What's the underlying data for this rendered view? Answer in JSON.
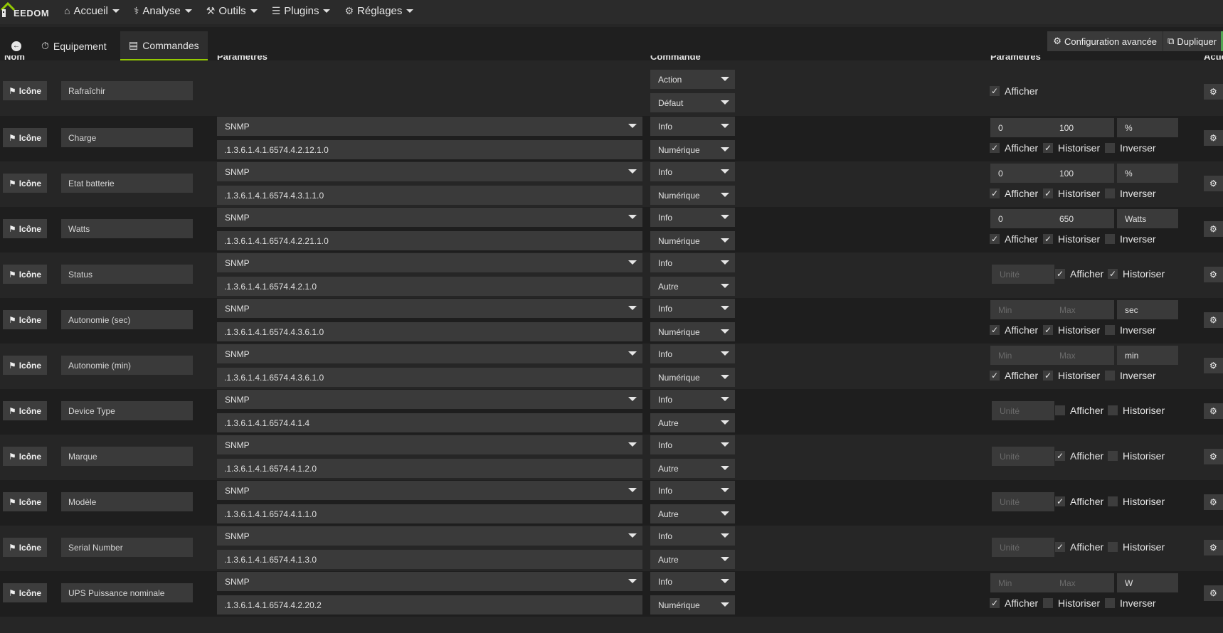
{
  "brand": "EEDOM",
  "nav": [
    {
      "label": "Accueil",
      "icon": "home-icon"
    },
    {
      "label": "Analyse",
      "icon": "stethoscope-icon"
    },
    {
      "label": "Outils",
      "icon": "wrench-icon"
    },
    {
      "label": "Plugins",
      "icon": "tasks-icon"
    },
    {
      "label": "Réglages",
      "icon": "gear-icon"
    }
  ],
  "tabs": {
    "equipement": "Equipement",
    "commandes": "Commandes"
  },
  "actions": {
    "advanced": "Configuration avancée",
    "duplicate": "Dupliquer"
  },
  "headers": {
    "nom": "Nom",
    "parametres": "Paramètres",
    "commande": "Commande",
    "parametres2": "Paramètres",
    "action": "Action"
  },
  "labels": {
    "icon_button": "Icône",
    "afficher": "Afficher",
    "historiser": "Historiser",
    "inverser": "Inverser",
    "min_placeholder": "Min",
    "max_placeholder": "Max",
    "unit_placeholder": "Unité"
  },
  "first_row": {
    "name": "Rafraîchir",
    "type": "Action",
    "subtype": "Défaut",
    "afficher": true
  },
  "rows": [
    {
      "name": "Charge",
      "protocol": "SNMP",
      "oid": ".1.3.6.1.4.1.6574.4.2.12.1.0",
      "type": "Info",
      "subtype": "Numérique",
      "layout": "minmax",
      "min": "0",
      "max": "100",
      "unit": "%",
      "afficher": true,
      "historiser": true,
      "inverser": false
    },
    {
      "name": "Etat batterie",
      "protocol": "SNMP",
      "oid": ".1.3.6.1.4.1.6574.4.3.1.1.0",
      "type": "Info",
      "subtype": "Numérique",
      "layout": "minmax",
      "min": "0",
      "max": "100",
      "unit": "%",
      "afficher": true,
      "historiser": true,
      "inverser": false
    },
    {
      "name": "Watts",
      "protocol": "SNMP",
      "oid": ".1.3.6.1.4.1.6574.4.2.21.1.0",
      "type": "Info",
      "subtype": "Numérique",
      "layout": "minmax",
      "min": "0",
      "max": "650",
      "unit": "Watts",
      "afficher": true,
      "historiser": true,
      "inverser": false
    },
    {
      "name": "Status",
      "protocol": "SNMP",
      "oid": ".1.3.6.1.4.1.6574.4.2.1.0",
      "type": "Info",
      "subtype": "Autre",
      "layout": "unit",
      "unit": "",
      "afficher": true,
      "historiser": true
    },
    {
      "name": "Autonomie (sec)",
      "protocol": "SNMP",
      "oid": ".1.3.6.1.4.1.6574.4.3.6.1.0",
      "type": "Info",
      "subtype": "Numérique",
      "layout": "minmax",
      "min": "",
      "max": "",
      "unit": "sec",
      "afficher": true,
      "historiser": true,
      "inverser": false
    },
    {
      "name": "Autonomie (min)",
      "protocol": "SNMP",
      "oid": ".1.3.6.1.4.1.6574.4.3.6.1.0",
      "type": "Info",
      "subtype": "Numérique",
      "layout": "minmax",
      "min": "",
      "max": "",
      "unit": "min",
      "afficher": true,
      "historiser": true,
      "inverser": false
    },
    {
      "name": "Device Type",
      "protocol": "SNMP",
      "oid": ".1.3.6.1.4.1.6574.4.1.4",
      "type": "Info",
      "subtype": "Autre",
      "layout": "unit",
      "unit": "",
      "afficher": false,
      "historiser": false
    },
    {
      "name": "Marque",
      "protocol": "SNMP",
      "oid": ".1.3.6.1.4.1.6574.4.1.2.0",
      "type": "Info",
      "subtype": "Autre",
      "layout": "unit",
      "unit": "",
      "afficher": true,
      "historiser": false
    },
    {
      "name": "Modèle",
      "protocol": "SNMP",
      "oid": ".1.3.6.1.4.1.6574.4.1.1.0",
      "type": "Info",
      "subtype": "Autre",
      "layout": "unit",
      "unit": "",
      "afficher": true,
      "historiser": false
    },
    {
      "name": "Serial Number",
      "protocol": "SNMP",
      "oid": ".1.3.6.1.4.1.6574.4.1.3.0",
      "type": "Info",
      "subtype": "Autre",
      "layout": "unit",
      "unit": "",
      "afficher": true,
      "historiser": false
    },
    {
      "name": "UPS Puissance nominale",
      "protocol": "SNMP",
      "oid": ".1.3.6.1.4.1.6574.4.2.20.2",
      "type": "Info",
      "subtype": "Numérique",
      "layout": "minmax",
      "min": "",
      "max": "",
      "unit": "W",
      "afficher": true,
      "historiser": false,
      "inverser": false
    }
  ]
}
